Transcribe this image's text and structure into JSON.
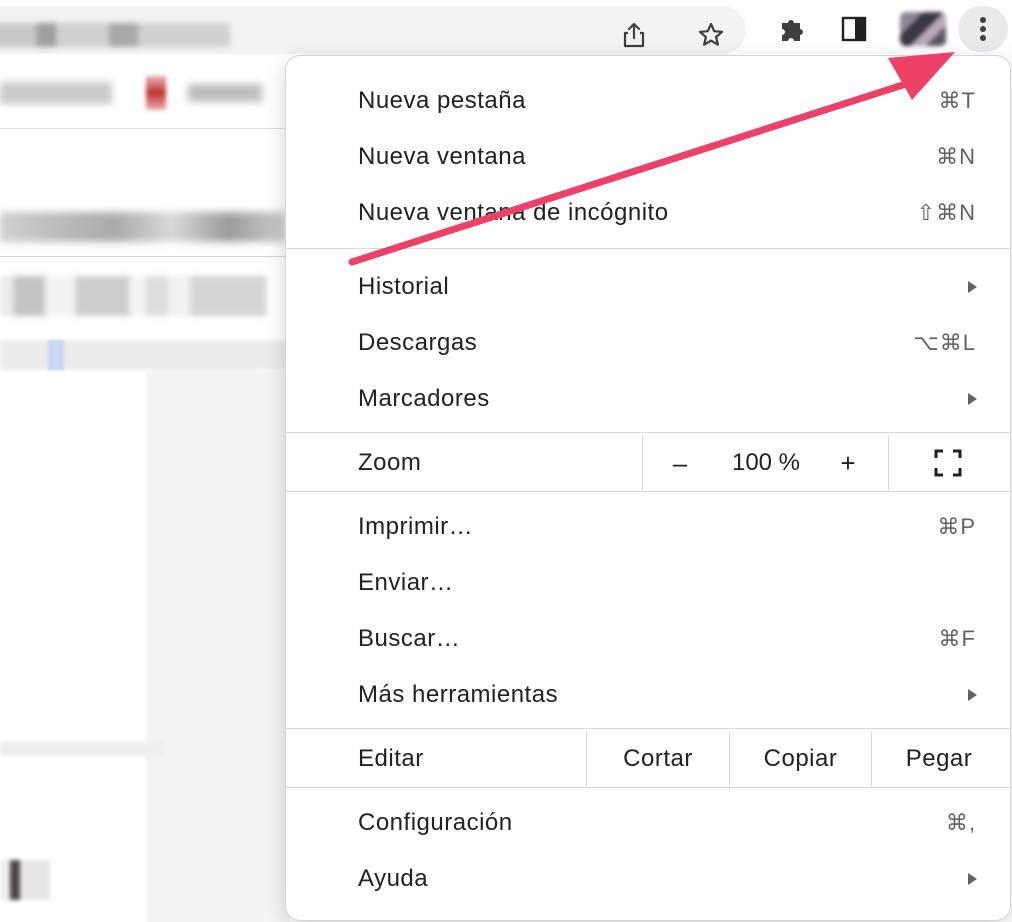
{
  "menu": {
    "items_top": [
      {
        "label": "Nueva pestaña",
        "shortcut": "⌘T"
      },
      {
        "label": "Nueva ventana",
        "shortcut": "⌘N"
      },
      {
        "label": "Nueva ventana de incógnito",
        "shortcut": "⇧⌘N"
      }
    ],
    "items_mid": [
      {
        "label": "Historial",
        "submenu": true
      },
      {
        "label": "Descargas",
        "shortcut": "⌥⌘L"
      },
      {
        "label": "Marcadores",
        "submenu": true
      }
    ],
    "zoom": {
      "label": "Zoom",
      "minus": "–",
      "value": "100 %",
      "plus": "+"
    },
    "items_tools": [
      {
        "label": "Imprimir…",
        "shortcut": "⌘P"
      },
      {
        "label": "Enviar…"
      },
      {
        "label": "Buscar…",
        "shortcut": "⌘F"
      },
      {
        "label": "Más herramientas",
        "submenu": true
      }
    ],
    "edit": {
      "label": "Editar",
      "cut": "Cortar",
      "copy": "Copiar",
      "paste": "Pegar"
    },
    "items_bottom": [
      {
        "label": "Configuración",
        "shortcut": "⌘,"
      },
      {
        "label": "Ayuda",
        "submenu": true
      }
    ]
  },
  "toolbar": {
    "icons": [
      "share-icon",
      "star-icon",
      "extensions-icon",
      "side-panel-icon",
      "profile-avatar",
      "kebab-menu-icon"
    ]
  },
  "colors": {
    "arrow": "#ec4168",
    "menu_bg": "#ffffff",
    "separator": "#d9d9d9",
    "shortcut_text": "#5f6368"
  }
}
